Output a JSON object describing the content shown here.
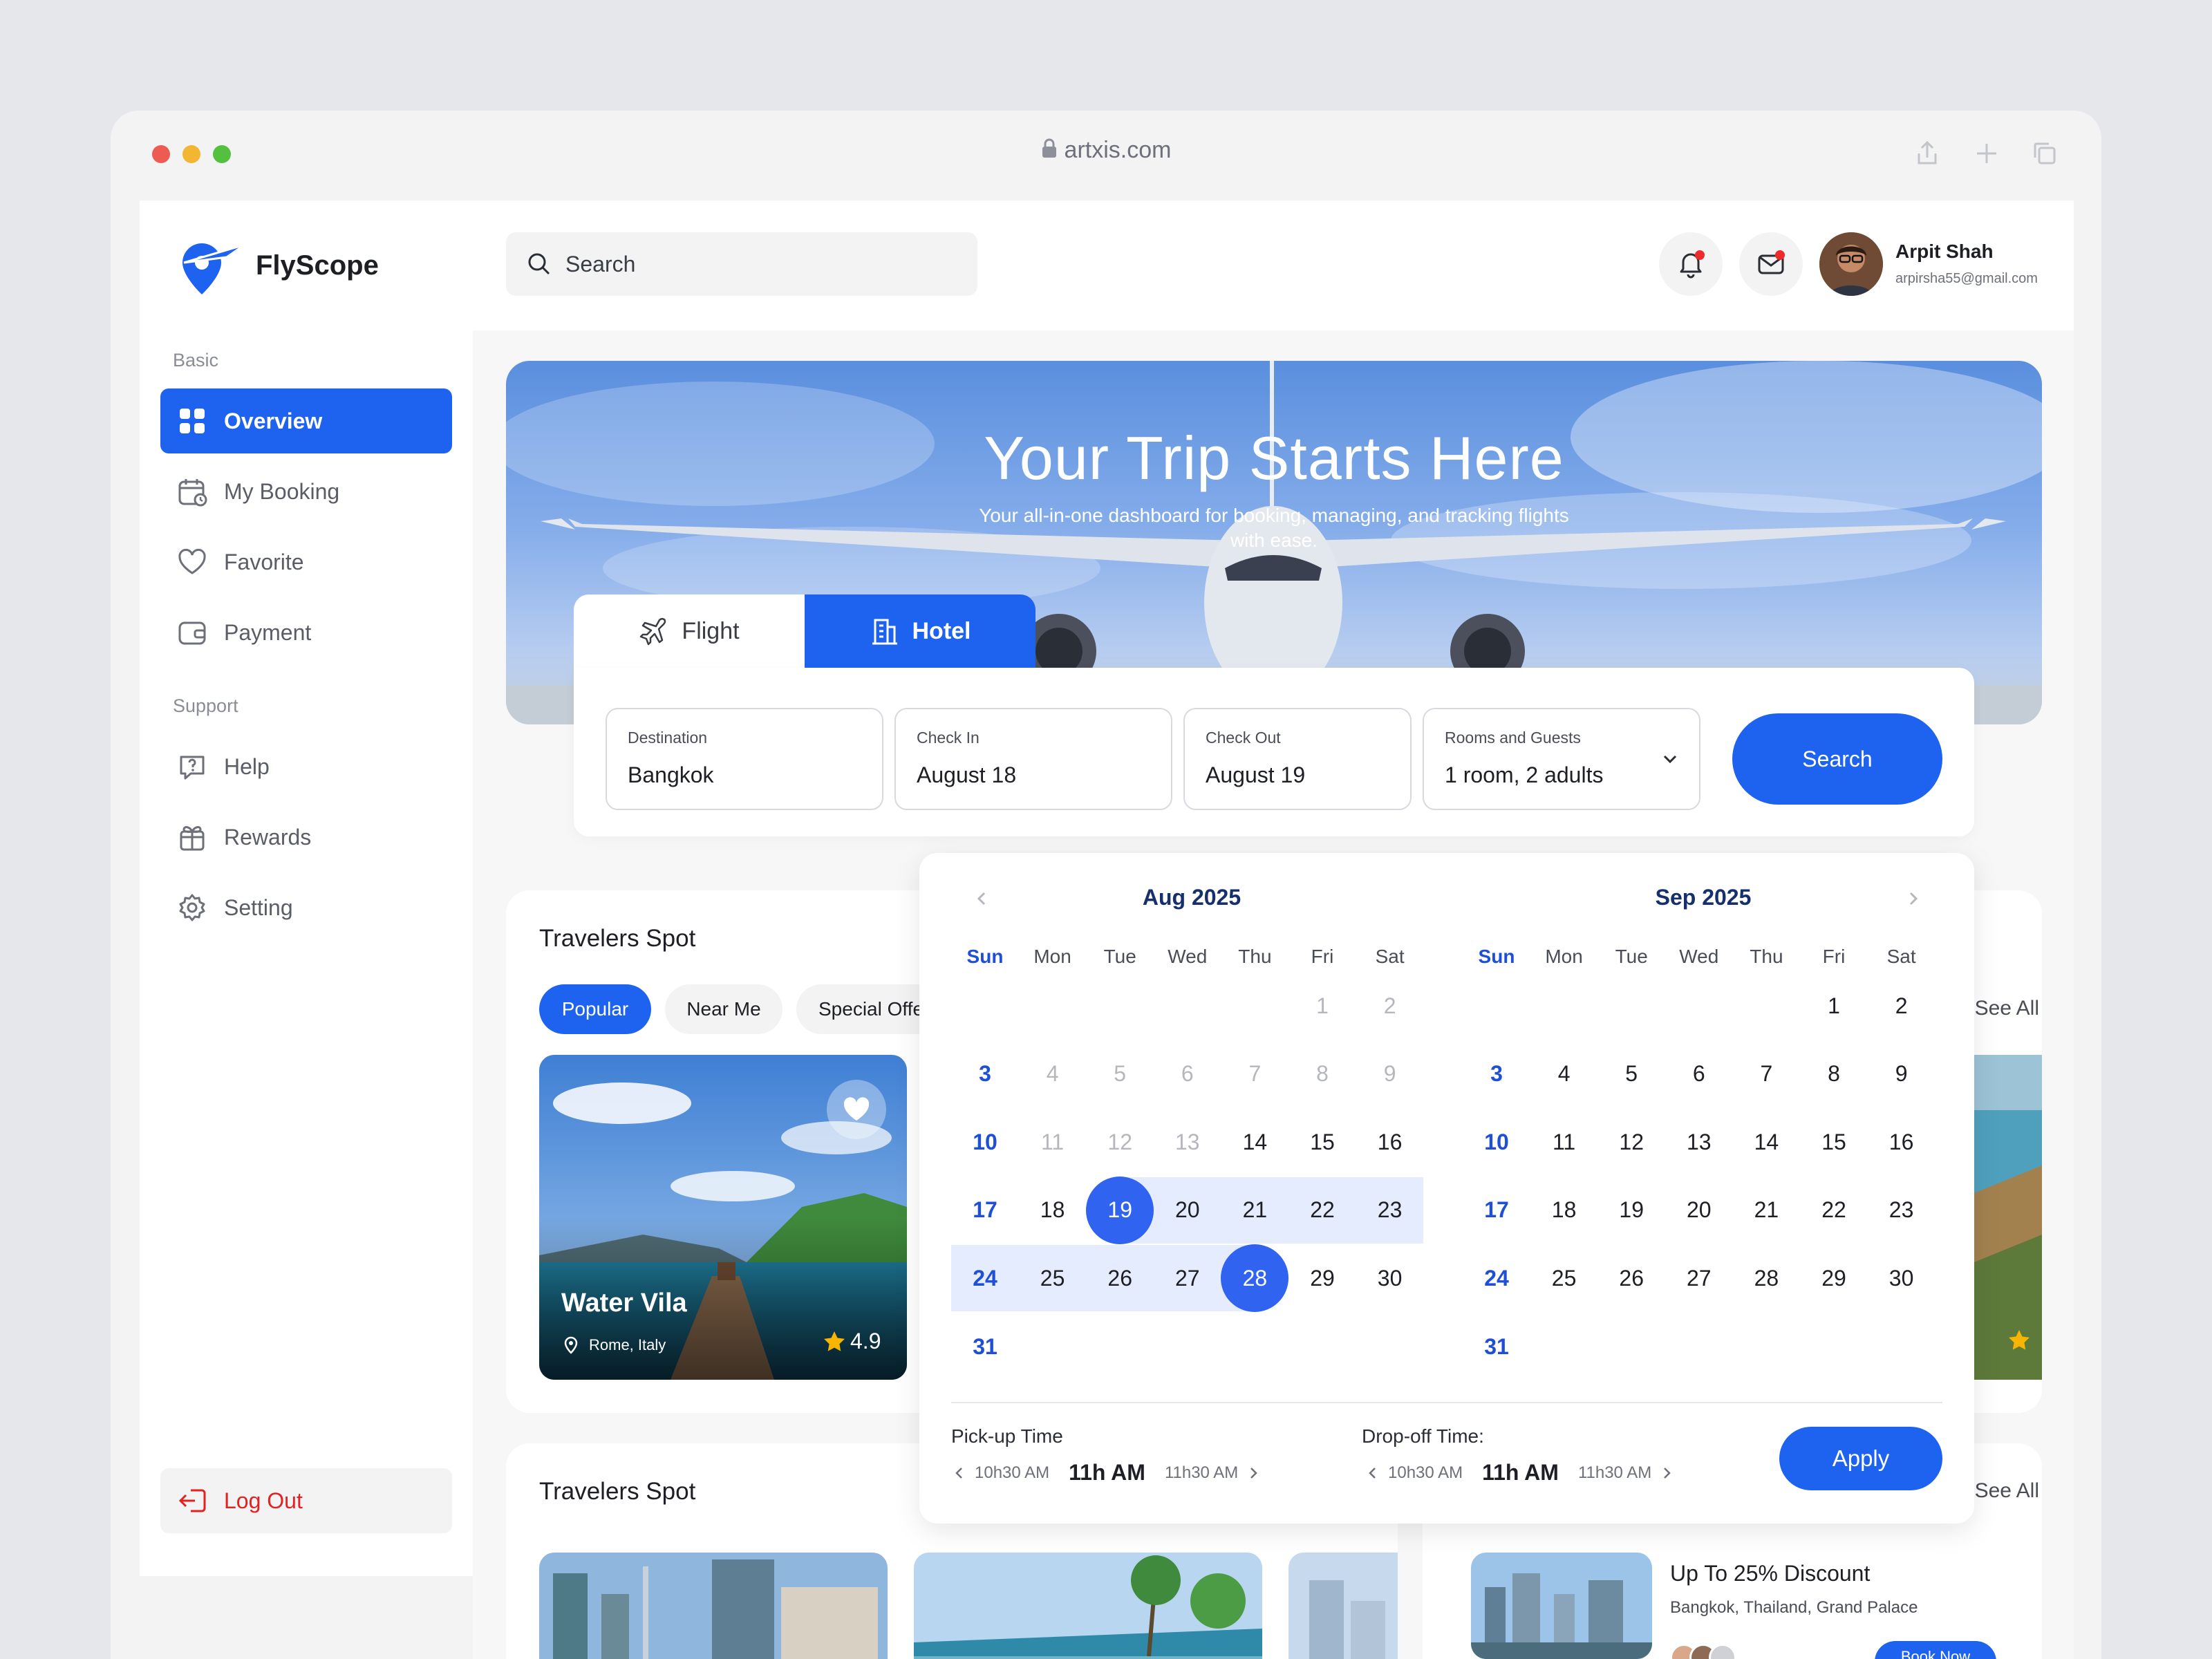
{
  "browser": {
    "url": "artxis.com"
  },
  "app": {
    "name": "FlyScope"
  },
  "sidebar": {
    "basic_label": "Basic",
    "support_label": "Support",
    "items": [
      {
        "label": "Overview",
        "icon": "grid-icon"
      },
      {
        "label": "My Booking",
        "icon": "calendar-icon"
      },
      {
        "label": "Favorite",
        "icon": "heart-icon"
      },
      {
        "label": "Payment",
        "icon": "wallet-icon"
      },
      {
        "label": "Help",
        "icon": "help-icon"
      },
      {
        "label": "Rewards",
        "icon": "gift-icon"
      },
      {
        "label": "Setting",
        "icon": "gear-icon"
      }
    ],
    "logout": "Log Out"
  },
  "header": {
    "search_placeholder": "Search",
    "user_name": "Arpit Shah",
    "user_email": "arpirsha55@gmail.com"
  },
  "hero": {
    "title": "Your Trip Starts Here",
    "subtitle": "Your all-in-one dashboard for booking, managing, and tracking flights with ease."
  },
  "booking": {
    "tabs": [
      "Flight",
      "Hotel"
    ],
    "active_tab": "Hotel",
    "fields": [
      {
        "label": "Destination",
        "value": "Bangkok"
      },
      {
        "label": "Check In",
        "value": "August 18"
      },
      {
        "label": "Check Out",
        "value": "August 19"
      },
      {
        "label": "Rooms and Guests",
        "value": "1 room, 2 adults"
      }
    ],
    "search_label": "Search"
  },
  "spots": {
    "title": "Travelers Spot",
    "filters": [
      "Popular",
      "Near Me",
      "Special Offers"
    ],
    "see_all": "See All",
    "card1": {
      "name": "Water Vila",
      "location": "Rome, Italy",
      "rating": "4.9"
    }
  },
  "spots2": {
    "title": "Travelers Spot",
    "see_all": "See All"
  },
  "promo": {
    "title": "Up To 25% Discount",
    "subtitle": "Bangkok, Thailand, Grand Palace",
    "button": "Book Now"
  },
  "calendar": {
    "weekdays": [
      "Sun",
      "Mon",
      "Tue",
      "Wed",
      "Thu",
      "Fri",
      "Sat"
    ],
    "months": [
      {
        "label": "Aug 2025",
        "lead_blank": 5,
        "days": 31,
        "muted_days": [
          1,
          2,
          4,
          5,
          6,
          7,
          8,
          9,
          11,
          12,
          13
        ],
        "check_in": 19,
        "check_out": 28
      },
      {
        "label": "Sep 2025",
        "lead_blank": 5,
        "days": 31,
        "muted_days": []
      }
    ],
    "pickup": {
      "label": "Pick-up Time",
      "prev": "10h30 AM",
      "current": "11h AM",
      "next": "11h30 AM"
    },
    "dropoff": {
      "label": "Drop-off Time:",
      "prev": "10h30 AM",
      "current": "11h AM",
      "next": "11h30 AM"
    },
    "apply_label": "Apply"
  },
  "colors": {
    "accent": "#1e63f0",
    "danger": "#e12222",
    "range": "#e5ecfd",
    "sunday": "#1e4fd6"
  }
}
